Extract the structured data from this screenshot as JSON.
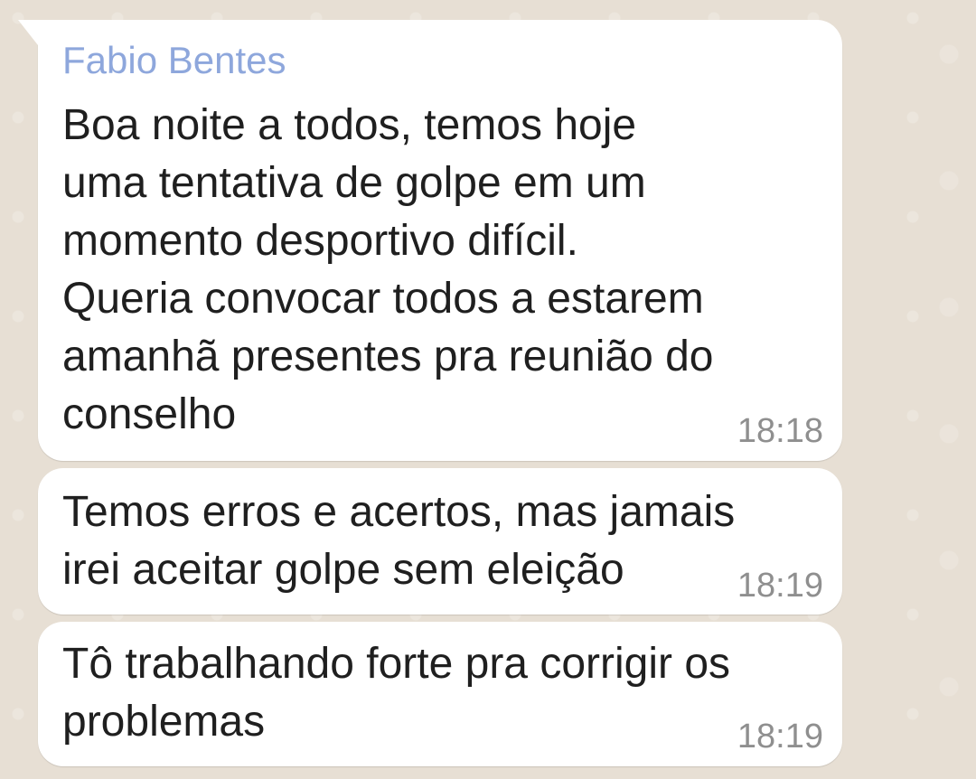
{
  "messages": [
    {
      "sender": "Fabio Bentes",
      "text": "Boa noite a todos, temos hoje\numa tentativa de golpe em um\nmomento desportivo difícil.\nQueria convocar todos a estarem\namanhã presentes pra reunião do\nconselho",
      "time": "18:18"
    },
    {
      "text": "Temos erros e acertos, mas jamais\nirei aceitar golpe sem eleição",
      "time": "18:19"
    },
    {
      "text": "Tô trabalhando forte pra corrigir os\nproblemas",
      "time": "18:19"
    }
  ],
  "colors": {
    "background": "#e7dfd4",
    "bubble": "#ffffff",
    "sender_name": "#8ea7dc",
    "message_text": "#1f1f1f",
    "timestamp": "#8f8f8f"
  }
}
